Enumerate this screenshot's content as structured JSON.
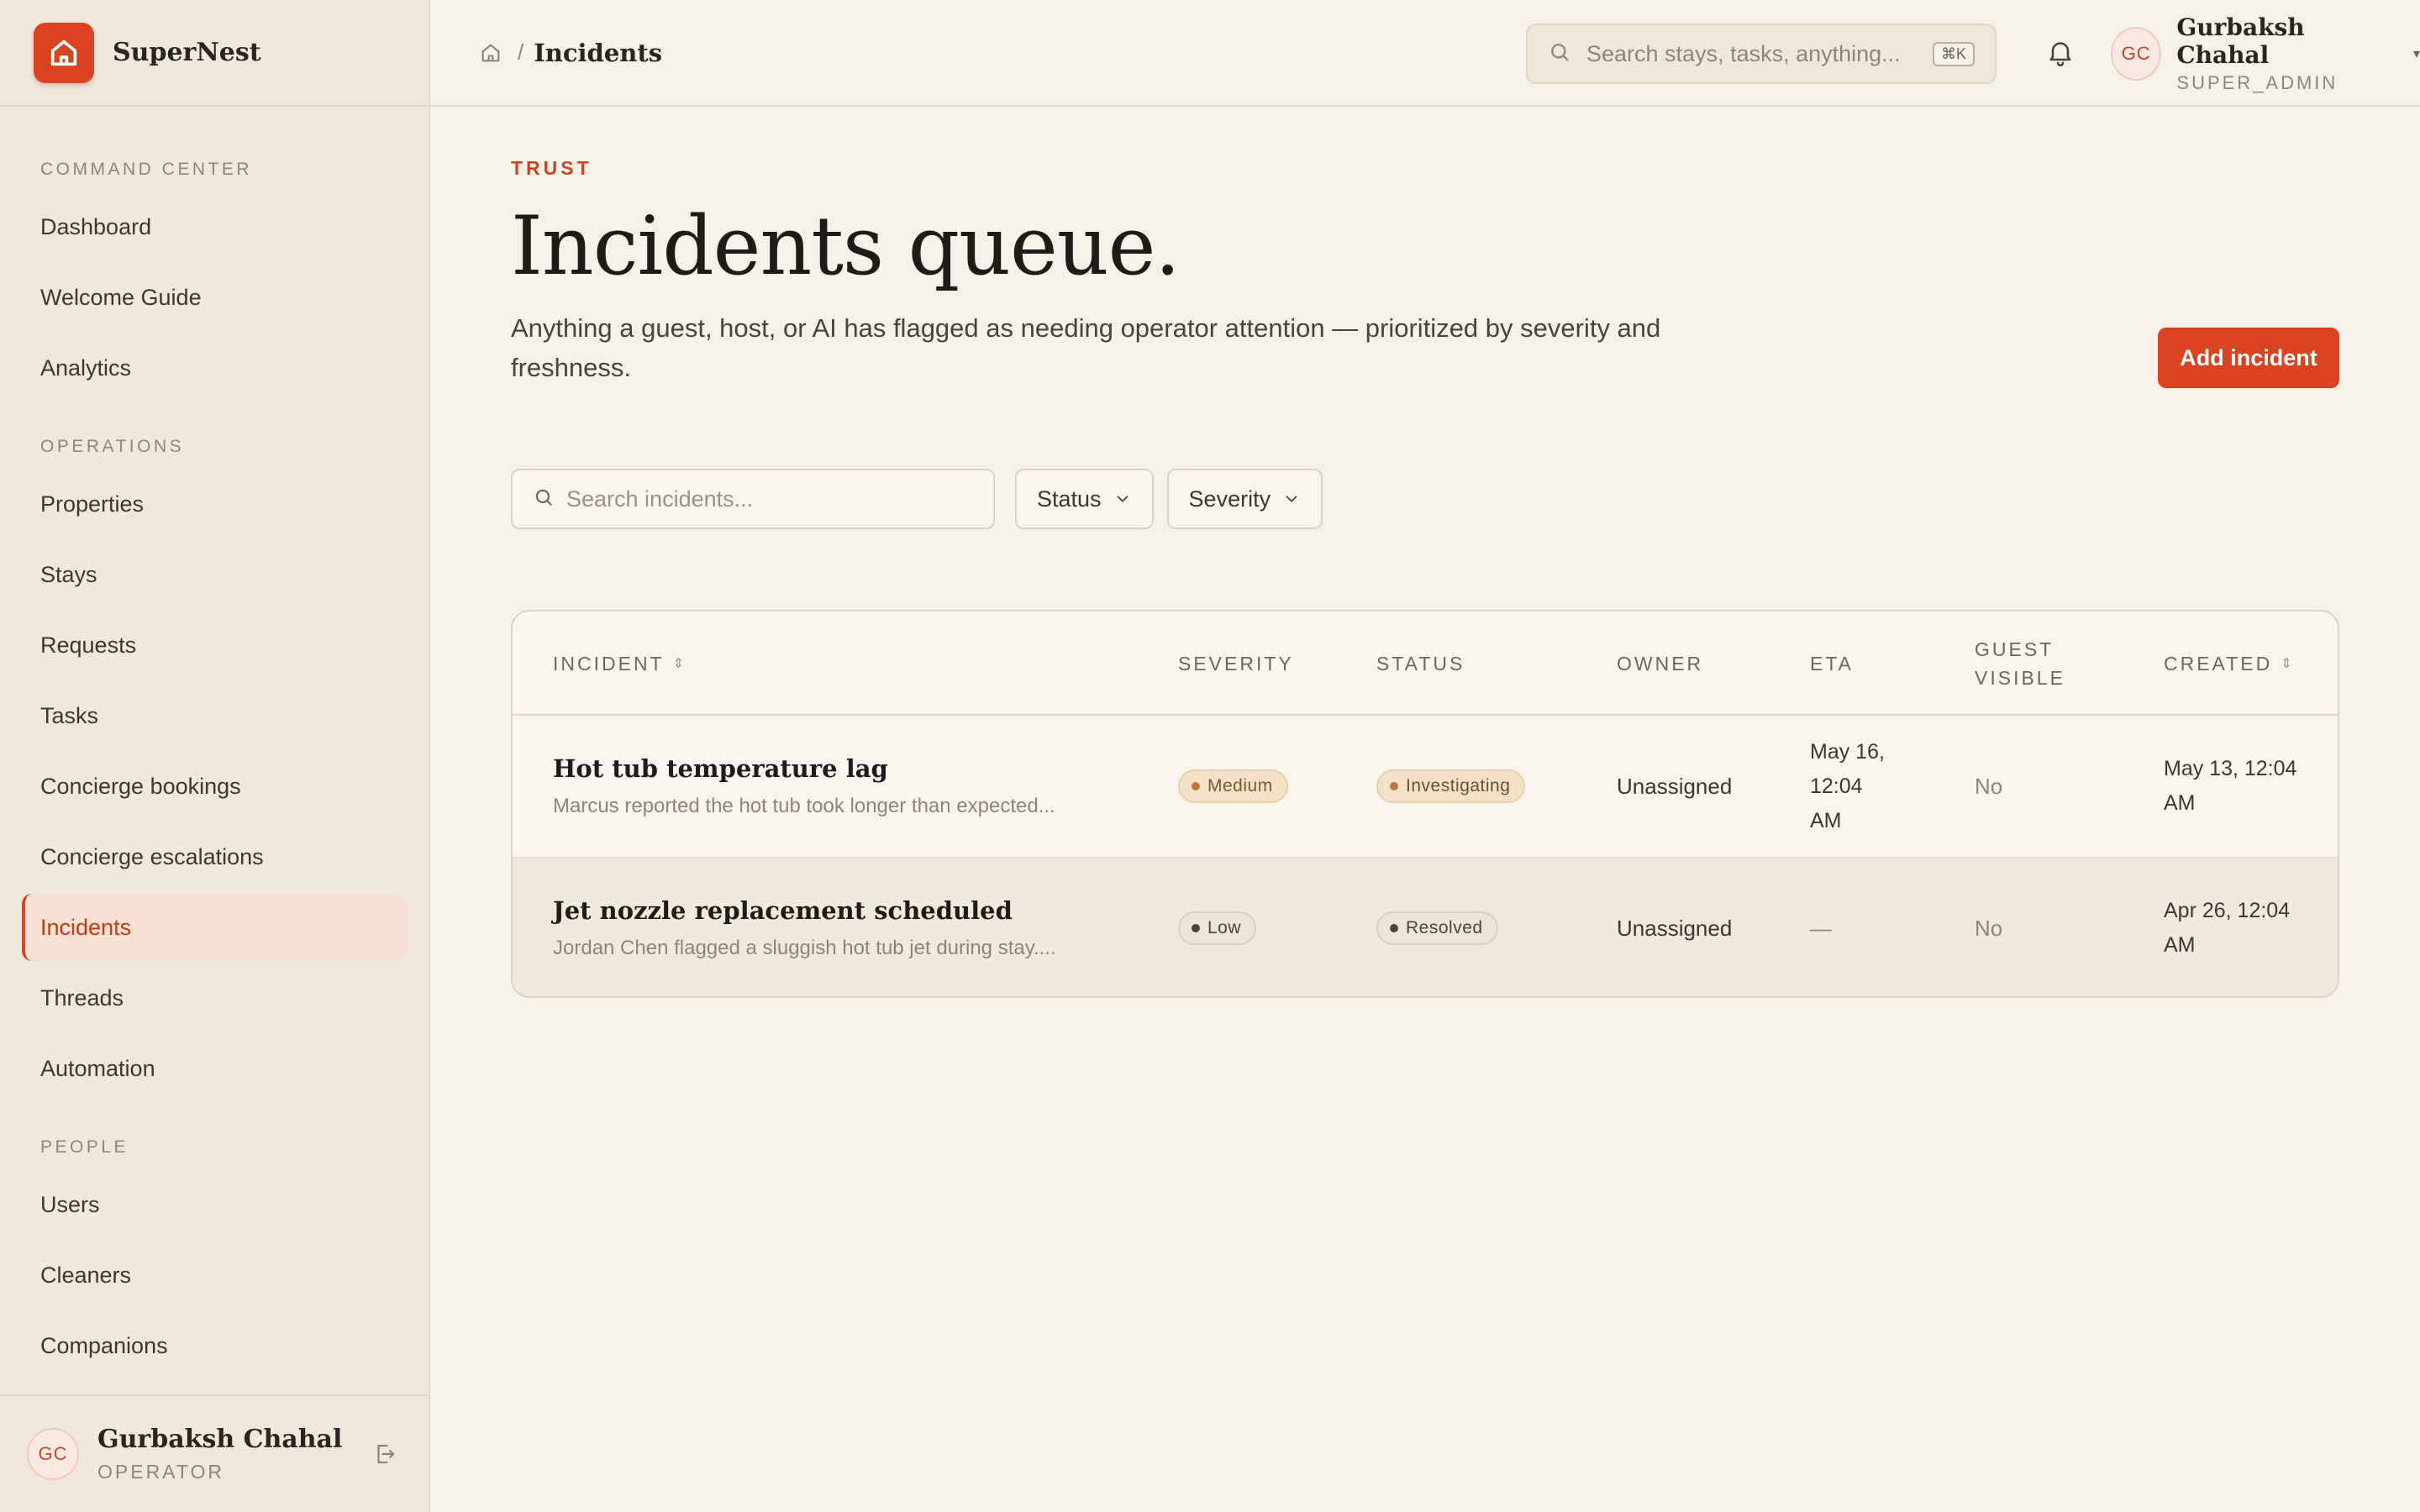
{
  "app": {
    "name": "SuperNest",
    "brand_color": "#d9431f"
  },
  "sidebar": {
    "sections": [
      {
        "heading": "COMMAND CENTER",
        "items": [
          {
            "label": "Dashboard"
          },
          {
            "label": "Welcome Guide"
          },
          {
            "label": "Analytics"
          }
        ]
      },
      {
        "heading": "OPERATIONS",
        "items": [
          {
            "label": "Properties"
          },
          {
            "label": "Stays"
          },
          {
            "label": "Requests"
          },
          {
            "label": "Tasks"
          },
          {
            "label": "Concierge bookings"
          },
          {
            "label": "Concierge escalations"
          },
          {
            "label": "Incidents",
            "active": true
          },
          {
            "label": "Threads"
          },
          {
            "label": "Automation"
          }
        ]
      },
      {
        "heading": "PEOPLE",
        "items": [
          {
            "label": "Users"
          },
          {
            "label": "Cleaners"
          },
          {
            "label": "Companions"
          }
        ]
      }
    ],
    "footer_user": {
      "initials": "GC",
      "name": "Gurbaksh Chahal",
      "role": "OPERATOR"
    }
  },
  "topbar": {
    "breadcrumb_current": "Incidents",
    "breadcrumb_separator": "/",
    "search_placeholder": "Search stays, tasks, anything...",
    "search_shortcut": "⌘K",
    "user": {
      "initials": "GC",
      "name": "Gurbaksh Chahal",
      "role": "SUPER_ADMIN"
    }
  },
  "page": {
    "eyebrow": "TRUST",
    "title": "Incidents queue.",
    "description": "Anything a guest, host, or AI has flagged as needing operator attention — prioritized by severity and freshness.",
    "add_button": "Add incident"
  },
  "filters": {
    "search_placeholder": "Search incidents...",
    "status_label": "Status",
    "severity_label": "Severity"
  },
  "table": {
    "columns": {
      "incident": "INCIDENT",
      "severity": "SEVERITY",
      "status": "STATUS",
      "owner": "OWNER",
      "eta": "ETA",
      "guest_visible_1": "GUEST",
      "guest_visible_2": "VISIBLE",
      "created": "CREATED"
    },
    "rows": [
      {
        "title": "Hot tub temperature lag",
        "subtitle": "Marcus reported the hot tub took longer than expected...",
        "severity": "Medium",
        "status": "Investigating",
        "owner": "Unassigned",
        "eta_1": "May 16,",
        "eta_2": "12:04",
        "eta_3": "AM",
        "guest_visible": "No",
        "created_1": "May 13, 12:04",
        "created_2": "AM"
      },
      {
        "title": "Jet nozzle replacement scheduled",
        "subtitle": "Jordan Chen flagged a sluggish hot tub jet during stay....",
        "severity": "Low",
        "status": "Resolved",
        "owner": "Unassigned",
        "eta": "—",
        "guest_visible": "No",
        "created_1": "Apr 26, 12:04",
        "created_2": "AM"
      }
    ]
  }
}
